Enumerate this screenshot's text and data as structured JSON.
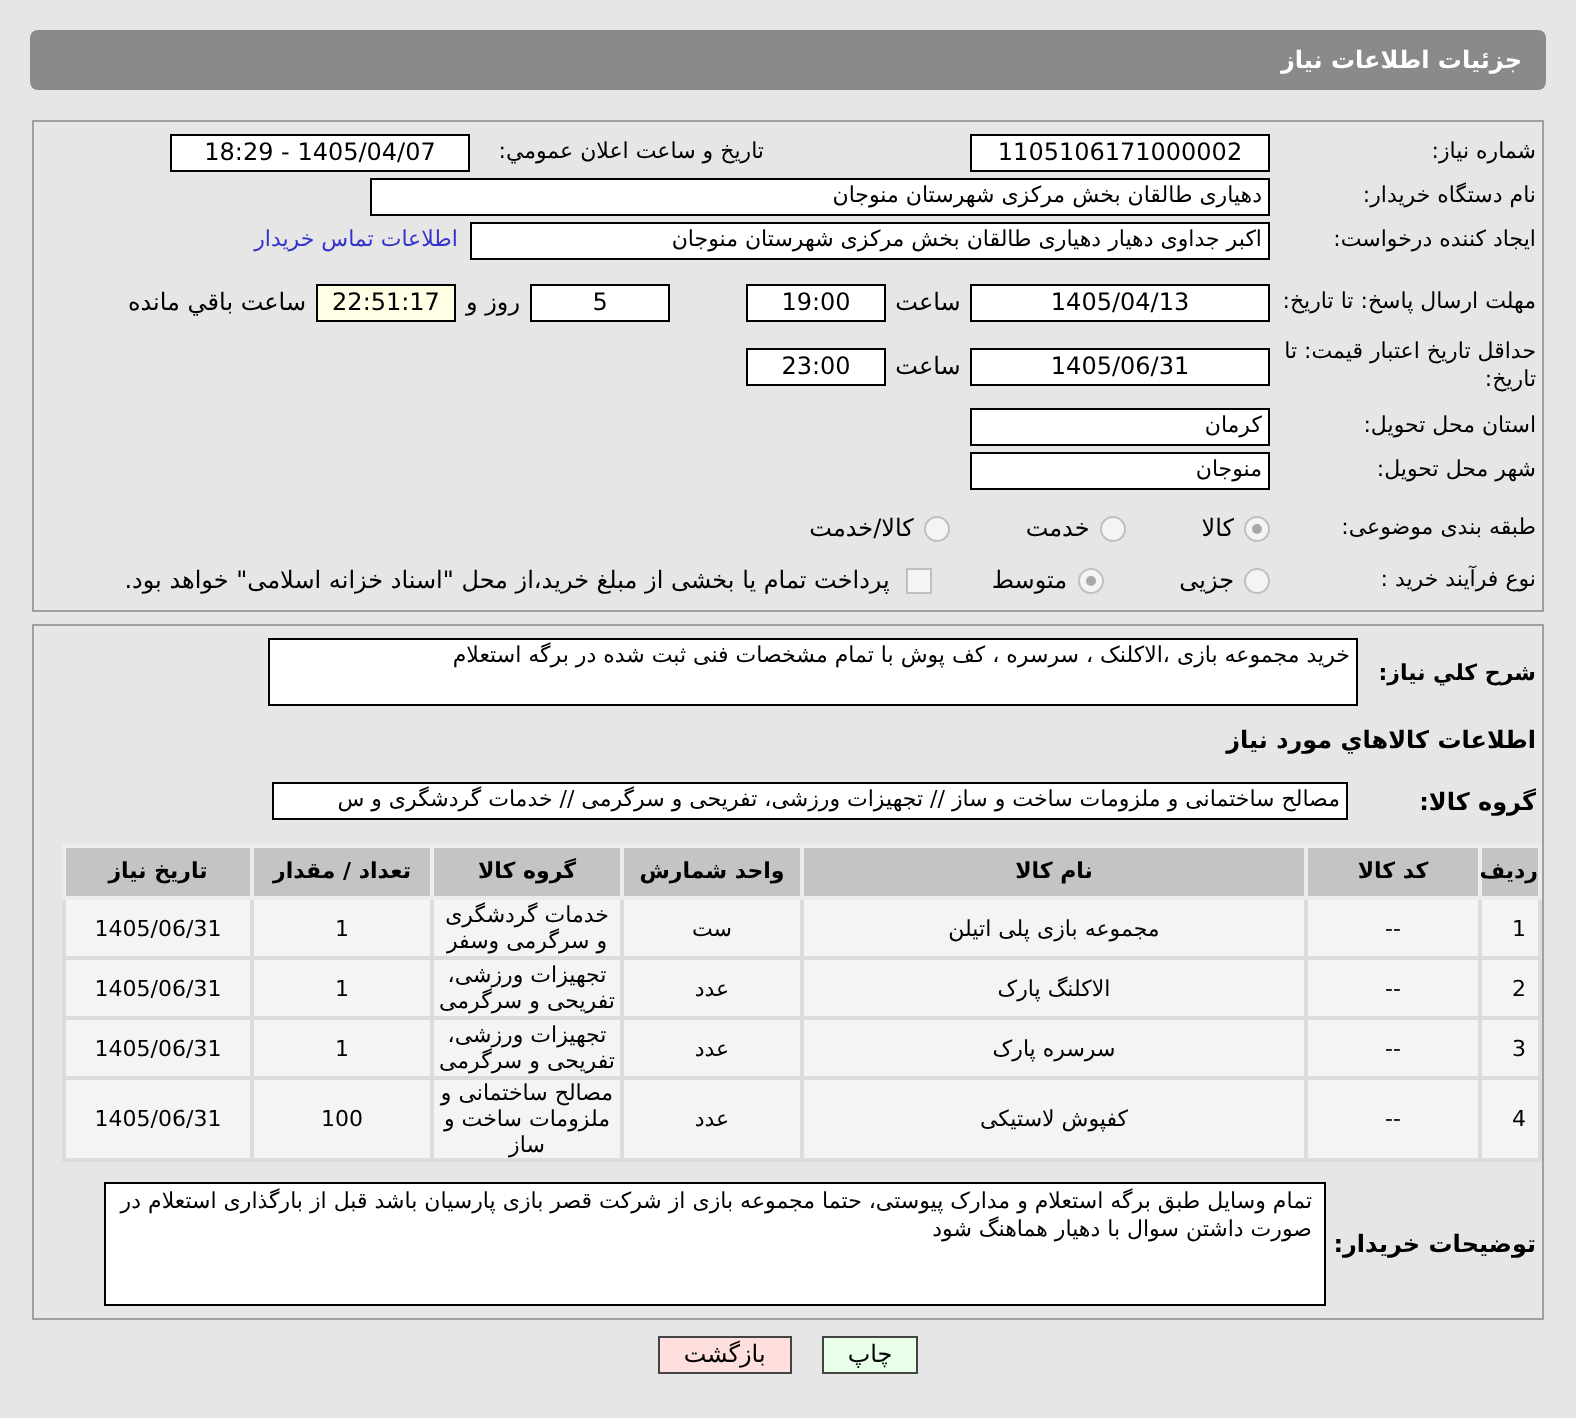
{
  "header": {
    "title": "جزئیات اطلاعات نیاز"
  },
  "need_info": {
    "need_number": {
      "label": "شماره نیاز:",
      "value": "1105106171000002"
    },
    "announce": {
      "label": "تاریخ و ساعت اعلان عمومي:",
      "value": "1405/04/07 - 18:29"
    },
    "buyer_org": {
      "label": "نام دستگاه خریدار:",
      "value": "دهیاری طالقان بخش مرکزی شهرستان منوجان"
    },
    "requester": {
      "label": "ایجاد کننده درخواست:",
      "value": "اکبر جداوی دهیار دهیاری طالقان بخش مرکزی شهرستان منوجان",
      "link": "اطلاعات تماس خریدار"
    },
    "deadline": {
      "label": "مهلت ارسال پاسخ: تا تاریخ:",
      "date": "1405/04/13",
      "time_label": "ساعت",
      "time": "19:00",
      "days": "5",
      "days_label": "روز و",
      "remaining": "22:51:17",
      "remaining_label": "ساعت باقي مانده"
    },
    "validity": {
      "label": "حداقل تاریخ اعتبار قیمت: تا تاریخ:",
      "date": "1405/06/31",
      "time_label": "ساعت",
      "time": "23:00"
    },
    "province": {
      "label": "استان محل تحویل:",
      "value": "کرمان"
    },
    "city": {
      "label": "شهر محل تحویل:",
      "value": "منوجان"
    },
    "category": {
      "label": "طبقه بندی موضوعی:",
      "options": [
        {
          "label": "کالا",
          "selected": true
        },
        {
          "label": "خدمت",
          "selected": false
        },
        {
          "label": "کالا/خدمت",
          "selected": false
        }
      ]
    },
    "process": {
      "label": "نوع فرآیند خرید :",
      "options": [
        {
          "label": "جزیی",
          "selected": false
        },
        {
          "label": "متوسط",
          "selected": true
        }
      ],
      "treasury": {
        "checked": false,
        "label": "پرداخت تمام یا بخشی از مبلغ خرید،از محل \"اسناد خزانه اسلامی\" خواهد بود."
      }
    }
  },
  "description": {
    "label": "شرح کلي نیاز:",
    "value": "خرید مجموعه بازی ،الاکلنک ، سرسره ، کف پوش با تمام مشخصات فنی ثبت شده در برگه استعلام"
  },
  "goods_heading": "اطلاعات کالاهاي مورد نیاز",
  "goods_group": {
    "label": "گروه کالا:",
    "value": "مصالح ساختمانی و ملزومات ساخت و ساز // تجهیزات ورزشی، تفریحی و سرگرمی // خدمات گردشگری و س"
  },
  "table": {
    "columns": [
      "ردیف",
      "کد کالا",
      "نام کالا",
      "واحد شمارش",
      "گروه کالا",
      "تعداد / مقدار",
      "تاریخ نیاز"
    ],
    "rows": [
      [
        "1",
        "--",
        "مجموعه بازی پلی اتیلن",
        "ست",
        "خدمات گردشگری و سرگرمی وسفر",
        "1",
        "1405/06/31"
      ],
      [
        "2",
        "--",
        "الاکلنگ پارک",
        "عدد",
        "تجهیزات ورزشی، تفریحی و سرگرمی",
        "1",
        "1405/06/31"
      ],
      [
        "3",
        "--",
        "سرسره پارک",
        "عدد",
        "تجهیزات ورزشی، تفریحی و سرگرمی",
        "1",
        "1405/06/31"
      ],
      [
        "4",
        "--",
        "کفپوش لاستیکی",
        "عدد",
        "مصالح ساختمانی و ملزومات ساخت و ساز",
        "100",
        "1405/06/31"
      ]
    ]
  },
  "buyer_notes": {
    "label": "توضیحات خریدار:",
    "value": "تمام وسایل طبق برگه استعلام و مدارک پیوستی، حتما مجموعه بازی از شرکت قصر بازی پارسیان باشد قبل از بارگذاری استعلام در صورت داشتن سوال با دهیار هماهنگ شود"
  },
  "buttons": [
    {
      "label": "چاپ",
      "kind": "print"
    },
    {
      "label": "بازگشت",
      "kind": "back"
    }
  ]
}
